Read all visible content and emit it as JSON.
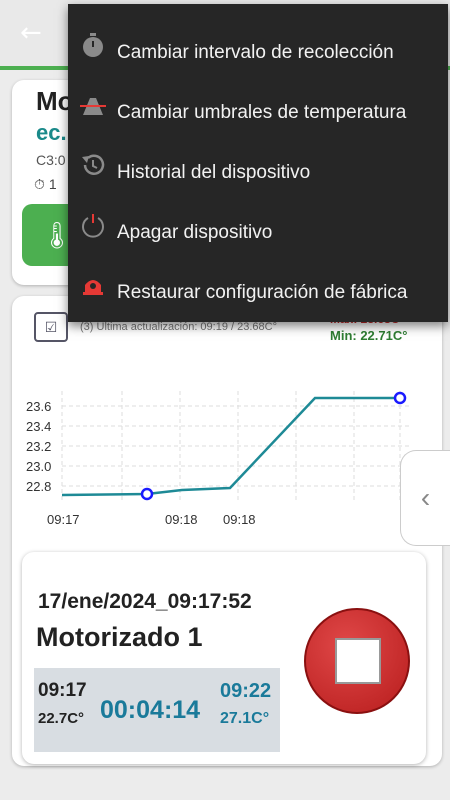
{
  "toolbar": {
    "back_icon": "back-arrow-icon"
  },
  "device_card": {
    "title": "Mo",
    "subtitle": "ec.",
    "info": "C3:0",
    "timer": "1",
    "temp_icon": "thermometer-icon"
  },
  "chart_card": {
    "update_text": "(3) Ultima actualización: 09:19 / 23.68C°",
    "max_text": "Max: 23.68C°",
    "min_text": "Min: 22.71C°"
  },
  "session_card": {
    "datetime": "17/ene/2024_09:17:52",
    "name": "Motorizado 1",
    "start_time": "09:17",
    "start_temp": "22.7C°",
    "elapsed": "00:04:14",
    "end_time": "09:22",
    "end_temp": "27.1C°"
  },
  "menu": {
    "items": [
      {
        "label": "Cambiar intervalo de recolección",
        "icon": "stopwatch-icon"
      },
      {
        "label": "Cambiar umbrales de temperatura",
        "icon": "threshold-icon"
      },
      {
        "label": "Historial del dispositivo",
        "icon": "history-icon"
      },
      {
        "label": "Apagar dispositivo",
        "icon": "power-icon"
      },
      {
        "label": "Restaurar configuración de fábrica",
        "icon": "factory-reset-icon"
      }
    ]
  },
  "colors": {
    "accent_green": "#4caf50",
    "teal": "#1a7a9a",
    "line": "#1e8a96",
    "stop_red": "#c62828"
  },
  "chart_data": {
    "type": "line",
    "x": [
      "09:17",
      "09:17",
      "09:18",
      "09:18",
      "09:19",
      "09:19"
    ],
    "series": [
      {
        "values": [
          22.71,
          22.72,
          22.76,
          22.78,
          23.68,
          23.68
        ]
      }
    ],
    "x_tick_labels": [
      "09:17",
      "09:18",
      "09:18"
    ],
    "y_ticks": [
      22.8,
      23.0,
      23.2,
      23.4,
      23.6
    ],
    "ylim": [
      22.65,
      23.75
    ],
    "markers_on": [
      1,
      5
    ],
    "grid": true
  }
}
